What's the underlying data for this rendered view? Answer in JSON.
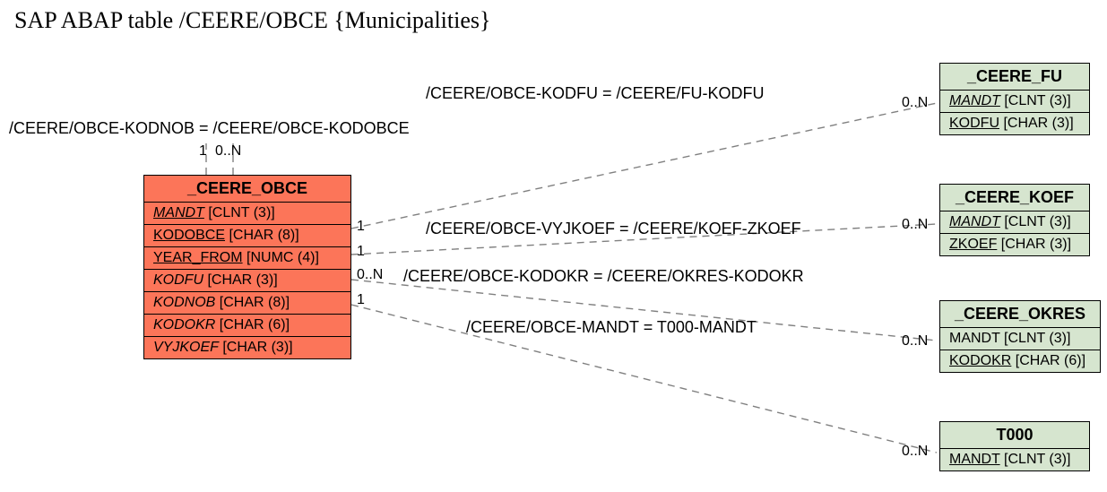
{
  "title": "SAP ABAP table /CEERE/OBCE {Municipalities}",
  "main_entity": {
    "name": "_CEERE_OBCE",
    "fields": [
      {
        "name": "MANDT",
        "type": "[CLNT (3)]",
        "key": true,
        "italic": true
      },
      {
        "name": "KODOBCE",
        "type": "[CHAR (8)]",
        "key": true,
        "italic": false
      },
      {
        "name": "YEAR_FROM",
        "type": "[NUMC (4)]",
        "key": true,
        "italic": false
      },
      {
        "name": "KODFU",
        "type": "[CHAR (3)]",
        "key": false,
        "italic": true
      },
      {
        "name": "KODNOB",
        "type": "[CHAR (8)]",
        "key": false,
        "italic": true
      },
      {
        "name": "KODOKR",
        "type": "[CHAR (6)]",
        "key": false,
        "italic": true
      },
      {
        "name": "VYJKOEF",
        "type": "[CHAR (3)]",
        "key": false,
        "italic": true
      }
    ]
  },
  "related_entities": [
    {
      "name": "_CEERE_FU",
      "fields": [
        {
          "name": "MANDT",
          "type": "[CLNT (3)]",
          "key": true,
          "italic": true
        },
        {
          "name": "KODFU",
          "type": "[CHAR (3)]",
          "key": true,
          "italic": false
        }
      ]
    },
    {
      "name": "_CEERE_KOEF",
      "fields": [
        {
          "name": "MANDT",
          "type": "[CLNT (3)]",
          "key": true,
          "italic": true
        },
        {
          "name": "ZKOEF",
          "type": "[CHAR (3)]",
          "key": true,
          "italic": false
        }
      ]
    },
    {
      "name": "_CEERE_OKRES",
      "fields": [
        {
          "name": "MANDT",
          "type": "[CLNT (3)]",
          "key": false,
          "italic": false
        },
        {
          "name": "KODOKR",
          "type": "[CHAR (6)]",
          "key": true,
          "italic": false
        }
      ]
    },
    {
      "name": "T000",
      "fields": [
        {
          "name": "MANDT",
          "type": "[CLNT (3)]",
          "key": true,
          "italic": false
        }
      ]
    }
  ],
  "relations": [
    {
      "label": "/CEERE/OBCE-KODFU = /CEERE/FU-KODFU"
    },
    {
      "label": "/CEERE/OBCE-VYJKOEF = /CEERE/KOEF-ZKOEF"
    },
    {
      "label": "/CEERE/OBCE-KODOKR = /CEERE/OKRES-KODOKR"
    },
    {
      "label": "/CEERE/OBCE-MANDT = T000-MANDT"
    }
  ],
  "self_relation": {
    "label": "/CEERE/OBCE-KODNOB = /CEERE/OBCE-KODOBCE"
  },
  "cardinality": {
    "self_left": "1",
    "self_right": "0..N",
    "src_fu": "1",
    "src_koef": "1",
    "src_okres": "0..N",
    "src_t000": "1",
    "dst_fu": "0..N",
    "dst_koef": "0..N",
    "dst_okres": "0..N",
    "dst_t000": "0..N"
  }
}
